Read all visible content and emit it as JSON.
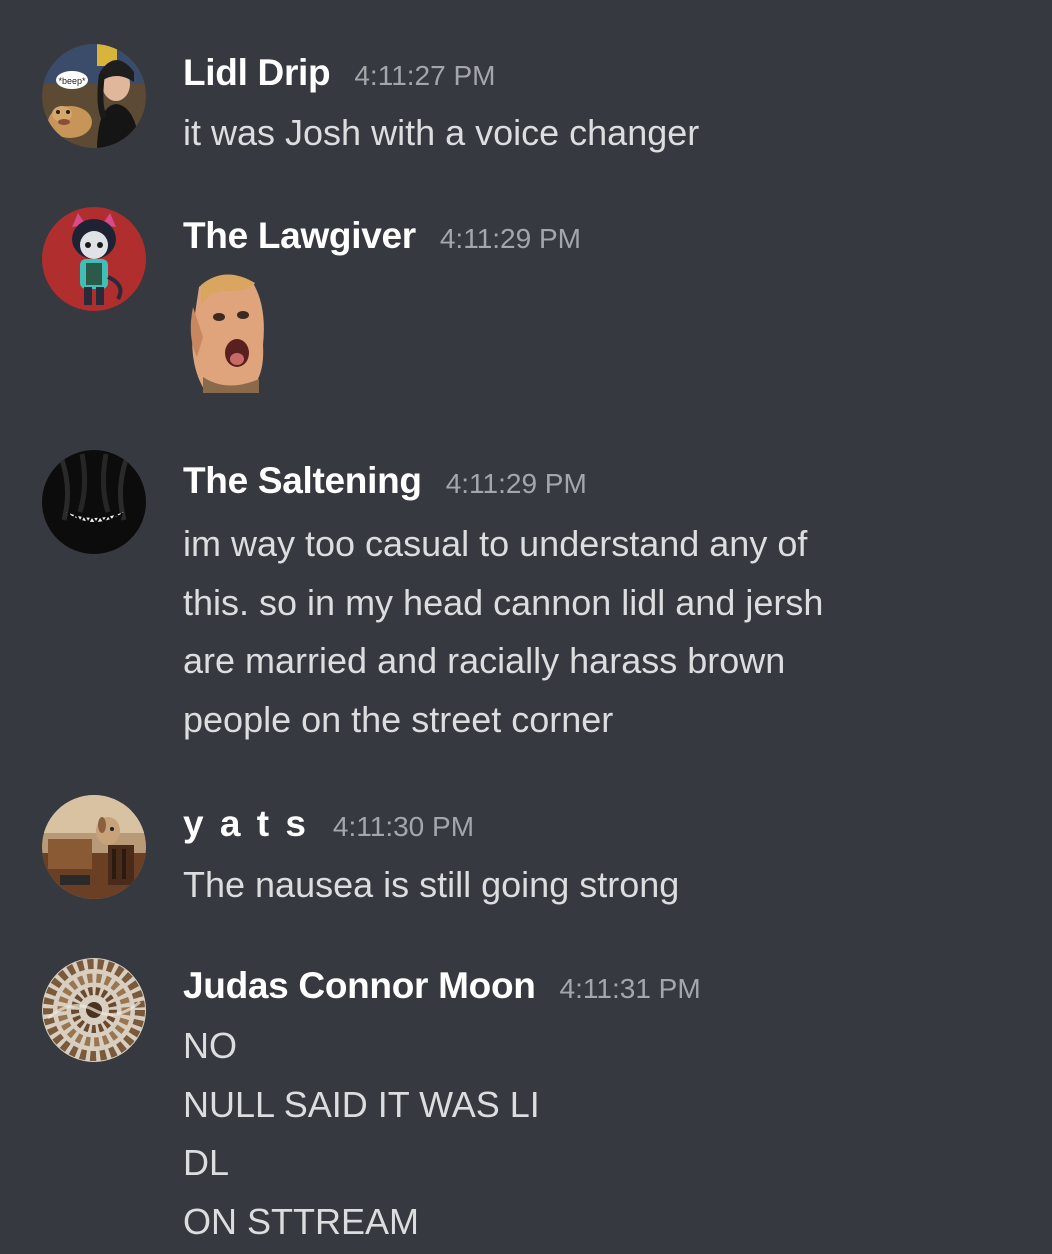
{
  "chat": {
    "messages": [
      {
        "author": "Lidl Drip",
        "time": "4:11:27 PM",
        "avatar_icon": "dog-and-person-avatar-icon",
        "avatar_badge_text": "*beep*",
        "lines": [
          "it was Josh with a voice changer"
        ]
      },
      {
        "author": "The Lawgiver",
        "time": "4:11:29 PM",
        "avatar_icon": "cartoon-character-avatar-icon",
        "emote": "screaming-face-emote",
        "lines": []
      },
      {
        "author": "The Saltening",
        "time": "4:11:29 PM",
        "avatar_icon": "grinning-shadow-avatar-icon",
        "lines": [
          "im way too casual to understand any of",
          "this. so in my head cannon lidl and jersh",
          "are married and racially harass brown",
          "people on the street corner"
        ]
      },
      {
        "author": "y a t s",
        "time": "4:11:30 PM",
        "avatar_icon": "dog-at-table-avatar-icon",
        "lines": [
          "The nausea is still going strong"
        ]
      },
      {
        "author": "Judas Connor Moon",
        "time": "4:11:31 PM",
        "avatar_icon": "spiral-pattern-avatar-icon",
        "lines": [
          "NO",
          "NULL SAID IT WAS LI",
          "DL",
          "ON STTREAM"
        ]
      }
    ]
  },
  "colors": {
    "background": "#36393f",
    "username": "#ffffff",
    "timestamp": "#a3a6aa",
    "message_text": "#dcddde"
  }
}
